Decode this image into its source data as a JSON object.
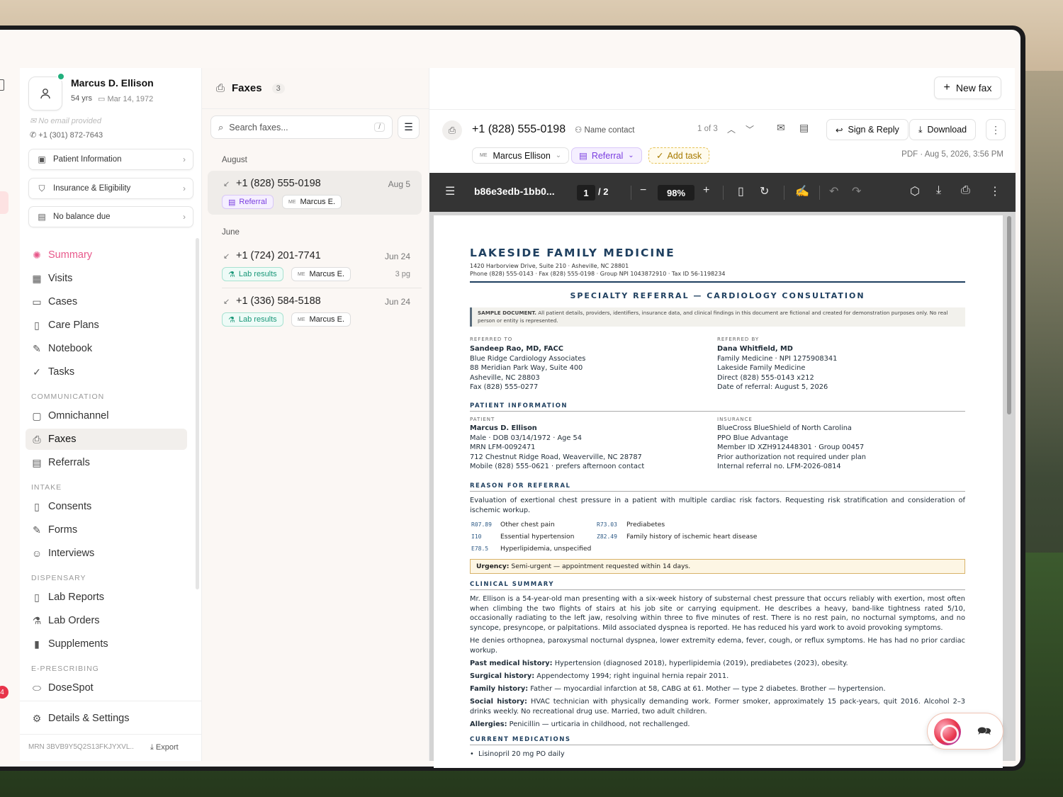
{
  "patient": {
    "name": "Marcus D. Ellison",
    "age": "54 yrs",
    "dob": "Mar 14, 1972",
    "email": "No email provided",
    "phone": "+1 (301) 872-7643",
    "mrn": "MRN 3BVB9Y5Q2S13FKJYXVL..",
    "export_label": "Export"
  },
  "sidebar_buttons": {
    "patient_info": "Patient Information",
    "insurance": "Insurance & Eligibility",
    "balance": "No balance due"
  },
  "nav": {
    "summary": "Summary",
    "visits": "Visits",
    "cases": "Cases",
    "care_plans": "Care Plans",
    "notebook": "Notebook",
    "tasks": "Tasks",
    "sec_communication": "COMMUNICATION",
    "omnichannel": "Omnichannel",
    "faxes": "Faxes",
    "referrals": "Referrals",
    "sec_intake": "INTAKE",
    "consents": "Consents",
    "forms": "Forms",
    "interviews": "Interviews",
    "sec_dispensary": "DISPENSARY",
    "lab_reports": "Lab Reports",
    "lab_orders": "Lab Orders",
    "supplements": "Supplements",
    "sec_eprescribing": "E-PRESCRIBING",
    "dosespot": "DoseSpot",
    "details_settings": "Details & Settings"
  },
  "left_badge": "4",
  "list": {
    "title": "Faxes",
    "count": "3",
    "search_placeholder": "Search faxes...",
    "search_key": "/",
    "group_august": "August",
    "group_june": "June",
    "items": [
      {
        "number": "+1 (828) 555-0198",
        "date": "Aug 5",
        "tag": "Referral",
        "patient": "Marcus E.",
        "initials": "ME",
        "pages": ""
      },
      {
        "number": "+1 (724) 201-7741",
        "date": "Jun 24",
        "tag": "Lab results",
        "patient": "Marcus E.",
        "initials": "ME",
        "pages": "3 pg"
      },
      {
        "number": "+1 (336) 584-5188",
        "date": "Jun 24",
        "tag": "Lab results",
        "patient": "Marcus E.",
        "initials": "ME",
        "pages": ""
      }
    ]
  },
  "detail": {
    "new_fax": "New fax",
    "number": "+1 (828) 555-0198",
    "name_contact": "Name contact",
    "position": "1 of 3",
    "sign_reply": "Sign & Reply",
    "download": "Download",
    "patient_chip": "Marcus Ellison",
    "patient_initials": "ME",
    "type_chip": "Referral",
    "add_task": "Add task",
    "pdf_meta": "PDF · Aug 5, 2026, 3:56 PM"
  },
  "toolbar": {
    "file_name": "b86e3edb-1bb0...",
    "page": "1",
    "total_pages": "/ 2",
    "zoom": "98%"
  },
  "doc": {
    "clinic": "LAKESIDE FAMILY MEDICINE",
    "addr1": "1420 Harborview Drive, Suite 210  ·  Asheville, NC 28801",
    "addr2": "Phone (828) 555-0143  ·  Fax (828) 555-0198  ·  Group NPI 1043872910  ·  Tax ID 56-1198234",
    "title": "SPECIALTY REFERRAL — CARDIOLOGY CONSULTATION",
    "sample_bold": "SAMPLE DOCUMENT.",
    "sample_text": " All patient details, providers, identifiers, insurance data, and clinical findings in this document are fictional and created for demonstration purposes only. No real person or entity is represented.",
    "referred_to_label": "REFERRED TO",
    "referred_to": [
      "Sandeep Rao, MD, FACC",
      "Blue Ridge Cardiology Associates",
      "88 Meridian Park Way, Suite 400",
      "Asheville, NC 28803",
      "Fax (828) 555-0277"
    ],
    "referred_by_label": "REFERRED BY",
    "referred_by": [
      "Dana Whitfield, MD",
      "Family Medicine · NPI 1275908341",
      "Lakeside Family Medicine",
      "Direct (828) 555-0143 x212",
      "Date of referral: August 5, 2026"
    ],
    "patient_info_head": "PATIENT INFORMATION",
    "patient_label": "PATIENT",
    "patient_lines": [
      "Marcus D. Ellison",
      "Male · DOB 03/14/1972 · Age 54",
      "MRN LFM-0092471",
      "712 Chestnut Ridge Road, Weaverville, NC 28787",
      "Mobile (828) 555-0621 · prefers afternoon contact"
    ],
    "insurance_label": "INSURANCE",
    "insurance_lines": [
      "BlueCross BlueShield of North Carolina",
      "PPO Blue Advantage",
      "Member ID XZH912448301 · Group 00457",
      "Prior authorization not required under plan",
      "Internal referral no. LFM-2026-0814"
    ],
    "reason_head": "REASON FOR REFERRAL",
    "reason_text": "Evaluation of exertional chest pressure in a patient with multiple cardiac risk factors. Requesting risk stratification and consideration of ischemic workup.",
    "icd": [
      {
        "code": "R07.89",
        "desc": "Other chest pain"
      },
      {
        "code": "I10",
        "desc": "Essential hypertension"
      },
      {
        "code": "E78.5",
        "desc": "Hyperlipidemia, unspecified"
      },
      {
        "code": "R73.03",
        "desc": "Prediabetes"
      },
      {
        "code": "Z82.49",
        "desc": "Family history of ischemic heart disease"
      }
    ],
    "urgency_label": "Urgency:",
    "urgency_text": " Semi-urgent — appointment requested within 14 days.",
    "clinical_head": "CLINICAL SUMMARY",
    "clinical_p1": "Mr. Ellison is a 54-year-old man presenting with a six-week history of substernal chest pressure that occurs reliably with exertion, most often when climbing the two flights of stairs at his job site or carrying equipment. He describes a heavy, band-like tightness rated 5/10, occasionally radiating to the left jaw, resolving within three to five minutes of rest. There is no rest pain, no nocturnal symptoms, and no syncope, presyncope, or palpitations. Mild associated dyspnea is reported. He has reduced his yard work to avoid provoking symptoms.",
    "clinical_p2": "He denies orthopnea, paroxysmal nocturnal dyspnea, lower extremity edema, fever, cough, or reflux symptoms. He has had no prior cardiac workup.",
    "pmh_label": "Past medical history:",
    "pmh": " Hypertension (diagnosed 2018), hyperlipidemia (2019), prediabetes (2023), obesity.",
    "surg_label": "Surgical history:",
    "surg": " Appendectomy 1994; right inguinal hernia repair 2011.",
    "fam_label": "Family history:",
    "fam": " Father — myocardial infarction at 58, CABG at 61. Mother — type 2 diabetes. Brother — hypertension.",
    "soc_label": "Social history:",
    "soc": " HVAC technician with physically demanding work. Former smoker, approximately 15 pack-years, quit 2016. Alcohol 2–3 drinks weekly. No recreational drug use. Married, two adult children.",
    "all_label": "Allergies:",
    "all": " Penicillin — urticaria in childhood, not rechallenged.",
    "meds_head": "CURRENT MEDICATIONS",
    "med1": "Lisinopril 20 mg PO daily"
  },
  "colors": {
    "accent_pink": "#e8598b",
    "referral_purple": "#7a3ee0",
    "lab_green": "#1b9879",
    "doc_navy": "#1e3f5f"
  }
}
